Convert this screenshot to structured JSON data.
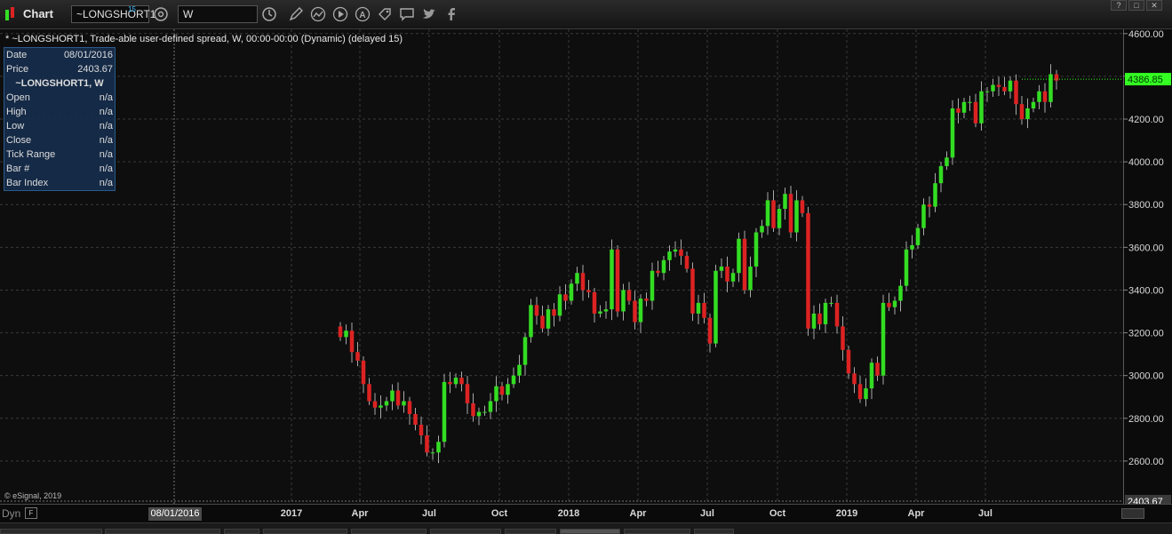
{
  "window": {
    "title": "Chart",
    "buttons": {
      "help": "?",
      "restore": "□",
      "close": "✕"
    }
  },
  "toolbar": {
    "symbol_value": "~LONGSHORT1",
    "symbol_badge": "15",
    "interval_value": "W",
    "icons": [
      "gear-icon",
      "clock-icon",
      "pencil-icon",
      "line-study-icon",
      "play-icon",
      "alert-icon",
      "tag-icon",
      "chat-icon",
      "twitter-icon",
      "facebook-icon"
    ]
  },
  "chart": {
    "header": "* ~LONGSHORT1, Trade-able user-defined spread, W, 00:00-00:00 (Dynamic) (delayed 15)",
    "copyright": "© eSignal, 2019",
    "last_price_label": "4386.85",
    "crosshair_price_label": "2403.67",
    "crosshair_date_label": "08/01/2016",
    "colors": {
      "up": "#33dd22",
      "down": "#dd2222",
      "last_price": "#33ff22",
      "grid": "#3a3a3a"
    }
  },
  "data_window": {
    "rows_top": [
      {
        "label": "Date",
        "value": "08/01/2016"
      },
      {
        "label": "Price",
        "value": "2403.67"
      }
    ],
    "title": "~LONGSHORT1, W",
    "rows": [
      {
        "label": "Open",
        "value": "n/a"
      },
      {
        "label": "High",
        "value": "n/a"
      },
      {
        "label": "Low",
        "value": "n/a"
      },
      {
        "label": "Close",
        "value": "n/a"
      },
      {
        "label": "Tick Range",
        "value": "n/a"
      },
      {
        "label": "Bar #",
        "value": "n/a"
      },
      {
        "label": "Bar Index",
        "value": "n/a"
      }
    ]
  },
  "time_axis": {
    "dyn_label": "Dyn",
    "ticks": [
      "2017",
      "Apr",
      "Jul",
      "Oct",
      "2018",
      "Apr",
      "Jul",
      "Oct",
      "2019",
      "Apr",
      "Jul"
    ]
  },
  "chart_data": {
    "type": "candlestick",
    "y_ticks": [
      "4600.00",
      "4400.00",
      "4200.00",
      "4000.00",
      "3800.00",
      "3600.00",
      "3400.00",
      "3200.00",
      "3000.00",
      "2800.00",
      "2600.00"
    ],
    "ylim": [
      2400,
      4620
    ],
    "closes": [
      3180,
      3210,
      3110,
      3070,
      2960,
      2880,
      2850,
      2860,
      2880,
      2930,
      2860,
      2880,
      2820,
      2770,
      2720,
      2640,
      2640,
      2690,
      2970,
      2960,
      2990,
      2960,
      2870,
      2810,
      2830,
      2830,
      2880,
      2950,
      2910,
      2960,
      3000,
      3050,
      3180,
      3330,
      3280,
      3220,
      3310,
      3280,
      3380,
      3350,
      3430,
      3480,
      3400,
      3390,
      3290,
      3300,
      3310,
      3590,
      3300,
      3400,
      3350,
      3250,
      3360,
      3350,
      3490,
      3480,
      3540,
      3580,
      3590,
      3560,
      3500,
      3290,
      3340,
      3270,
      3150,
      3490,
      3510,
      3440,
      3480,
      3640,
      3400,
      3510,
      3670,
      3700,
      3820,
      3690,
      3780,
      3850,
      3670,
      3820,
      3760,
      3220,
      3290,
      3240,
      3340,
      3340,
      3230,
      3120,
      3010,
      2960,
      2890,
      2940,
      3060,
      3000,
      3340,
      3320,
      3350,
      3420,
      3590,
      3610,
      3690,
      3800,
      3790,
      3900,
      3980,
      4020,
      4250,
      4230,
      4280,
      4280,
      4180,
      4330,
      4330,
      4360,
      4350,
      4330,
      4380,
      4270,
      4200,
      4250,
      4280,
      4330,
      4280,
      4410,
      4380
    ]
  }
}
